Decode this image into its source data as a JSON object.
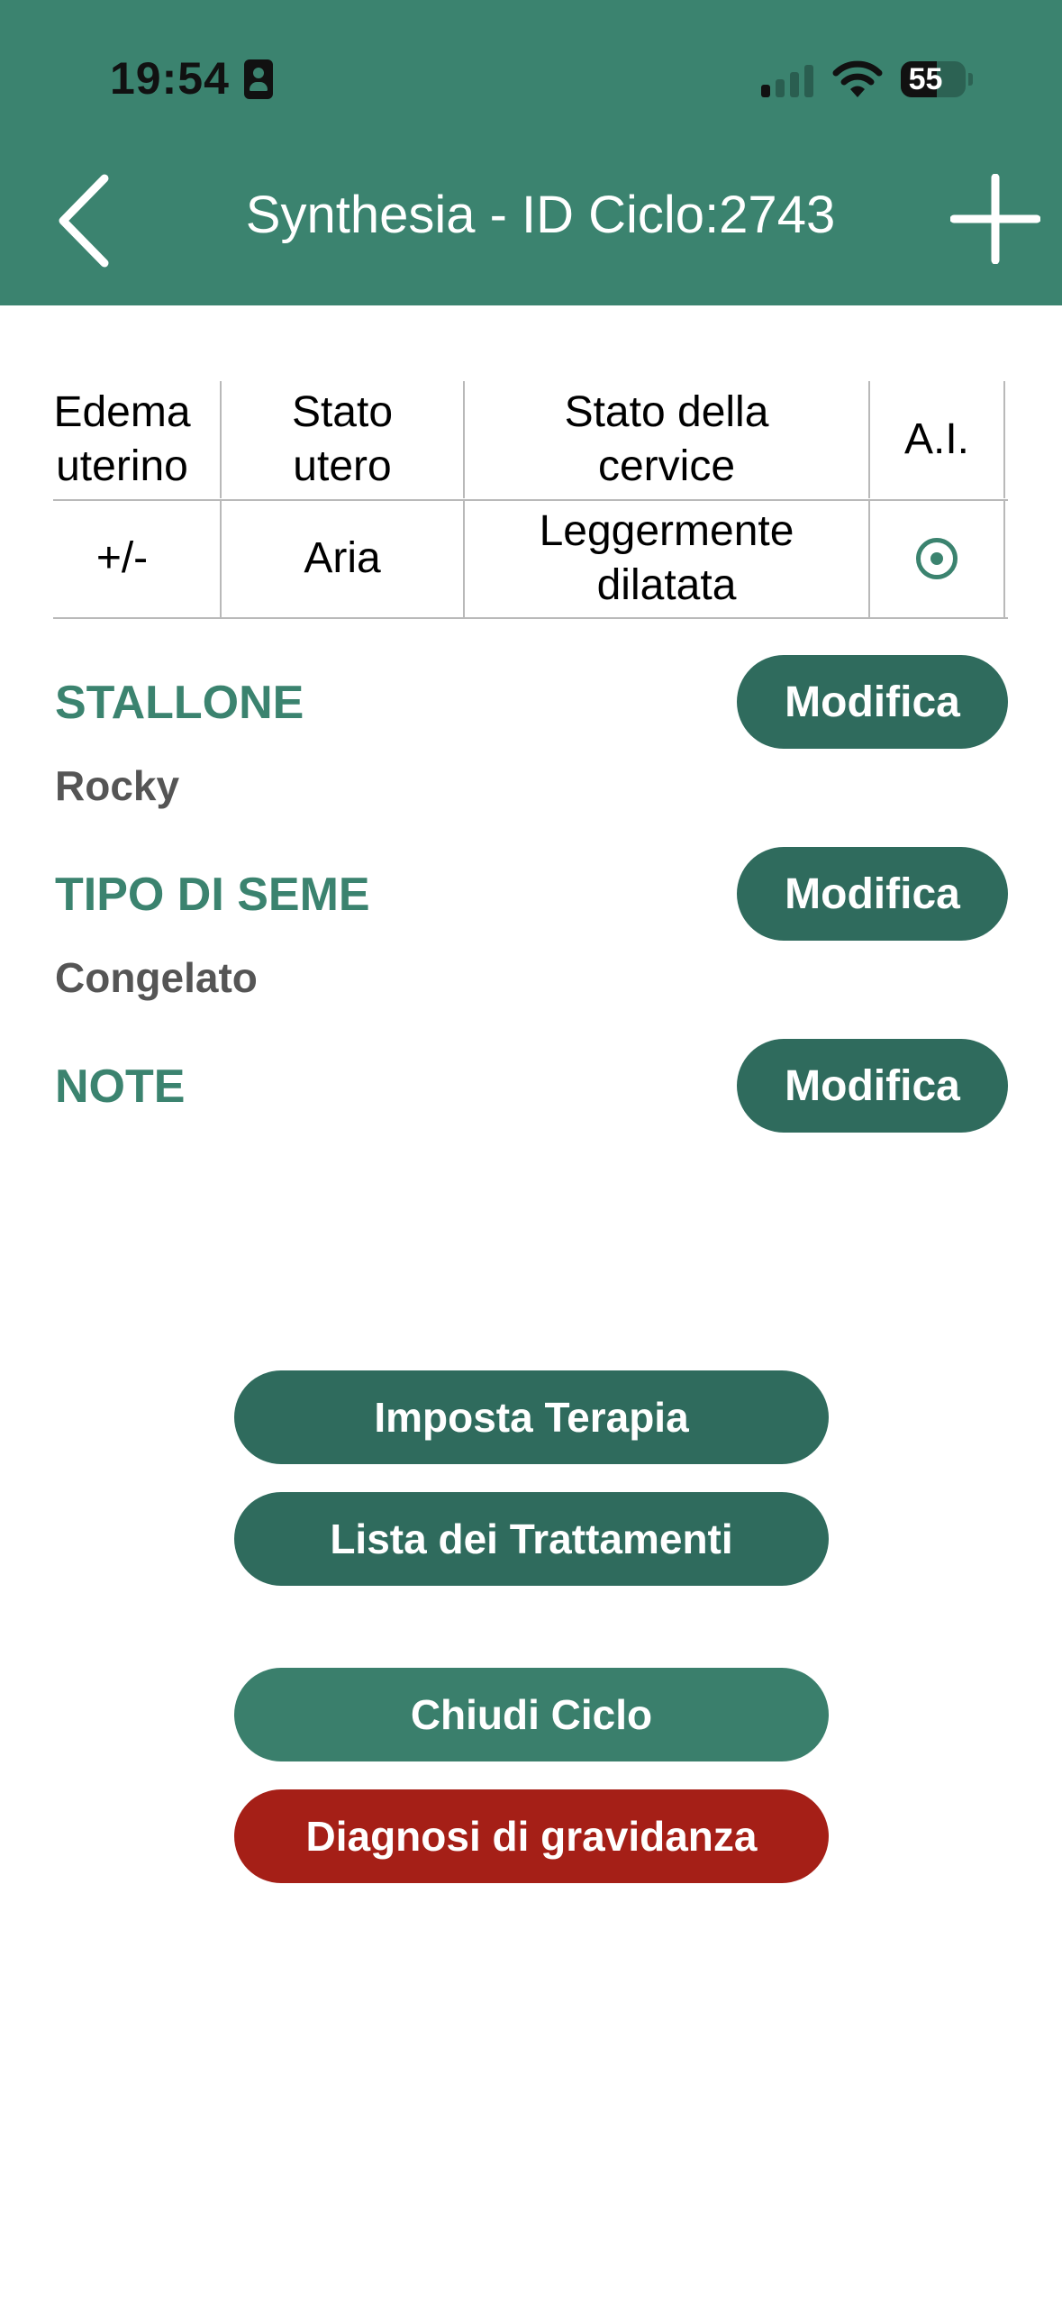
{
  "status_bar": {
    "time": "19:54",
    "battery_level": "55",
    "battery_fraction": 0.55,
    "signal_bars": 4,
    "signal_active": 1
  },
  "navbar": {
    "title": "Synthesia - ID Ciclo:2743",
    "back_icon": "chevron-left-icon",
    "add_icon": "plus-icon"
  },
  "table": {
    "headers": [
      "Edema uterino",
      "Stato utero",
      "Stato della cervice",
      "A.I."
    ],
    "header_lines": [
      [
        "Edema",
        "uterino"
      ],
      [
        "Stato",
        "utero"
      ],
      [
        "Stato della",
        "cervice"
      ],
      [
        "A.I."
      ]
    ],
    "rows": [
      {
        "edema": "+/-",
        "utero": "Aria",
        "cervice_lines": [
          "Leggermente",
          "dilatata"
        ],
        "ai_icon": "radio-selected-icon"
      }
    ]
  },
  "sections": [
    {
      "title": "STALLONE",
      "value": "Rocky",
      "button": "Modifica"
    },
    {
      "title": "TIPO DI SEME",
      "value": "Congelato",
      "button": "Modifica"
    },
    {
      "title": "NOTE",
      "value": "",
      "button": "Modifica"
    }
  ],
  "actions": {
    "imposta_terapia": "Imposta Terapia",
    "lista_trattamenti": "Lista dei Trattamenti",
    "chiudi_ciclo": "Chiudi Ciclo",
    "diagnosi_gravidanza": "Diagnosi di gravidanza"
  },
  "colors": {
    "header": "#3b836f",
    "accent_text": "#3b836f",
    "button_dark": "#2f6b5d",
    "button_chiudi": "#3a7f6c",
    "button_danger": "#a51f17",
    "value_text": "#555555"
  }
}
